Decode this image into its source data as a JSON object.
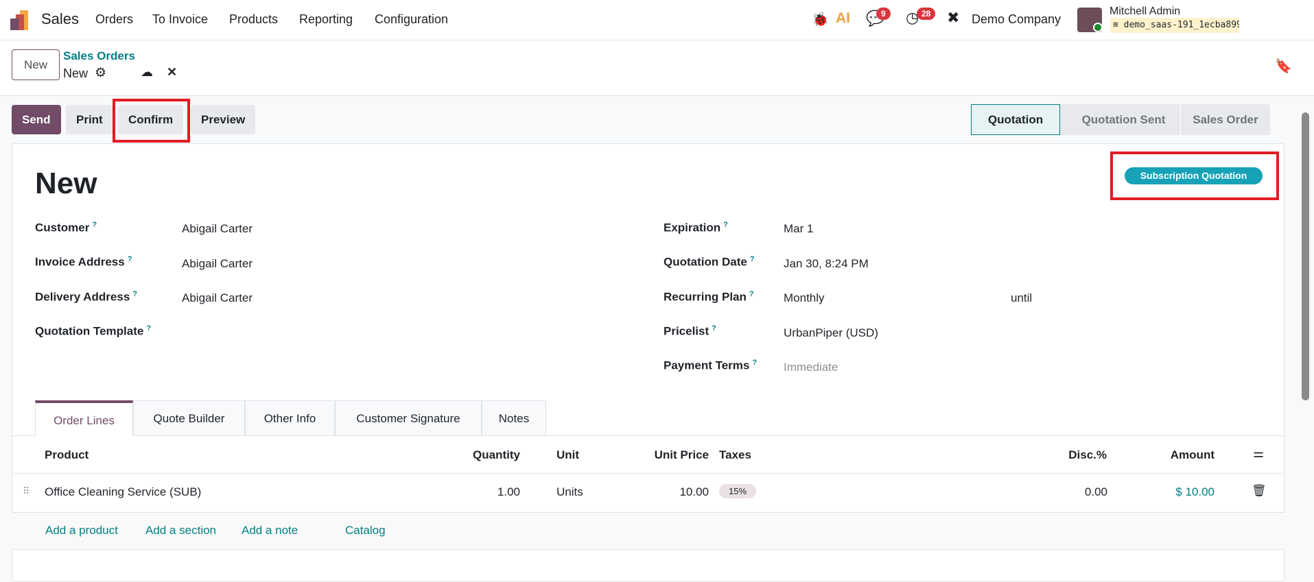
{
  "nav": {
    "app": "Sales",
    "menu": [
      "Orders",
      "To Invoice",
      "Products",
      "Reporting",
      "Configuration"
    ],
    "chat_count": "9",
    "activity_count": "28",
    "company": "Demo Company",
    "user": "Mitchell Admin",
    "database": "demo_saas-191_1ecba8990a5f…"
  },
  "control": {
    "new_label": "New",
    "breadcrumb": "Sales Orders",
    "record": "New"
  },
  "actions": {
    "send": "Send",
    "print": "Print",
    "confirm": "Confirm",
    "preview": "Preview"
  },
  "status": {
    "steps": [
      "Quotation",
      "Quotation Sent",
      "Sales Order"
    ],
    "active": "Quotation"
  },
  "form": {
    "title": "New",
    "badge": "Subscription Quotation",
    "left": [
      {
        "label": "Customer",
        "value": "Abigail Carter"
      },
      {
        "label": "Invoice Address",
        "value": "Abigail Carter"
      },
      {
        "label": "Delivery Address",
        "value": "Abigail Carter"
      },
      {
        "label": "Quotation Template",
        "value": ""
      }
    ],
    "right": [
      {
        "label": "Expiration",
        "value": "Mar 1"
      },
      {
        "label": "Quotation Date",
        "value": "Jan 30, 8:24 PM"
      },
      {
        "label": "Recurring Plan",
        "value": "Monthly"
      },
      {
        "label": "Pricelist",
        "value": "UrbanPiper (USD)"
      },
      {
        "label": "Payment Terms",
        "value": "Immediate"
      }
    ],
    "until": "until",
    "help": "?"
  },
  "tabs": [
    "Order Lines",
    "Quote Builder",
    "Other Info",
    "Customer Signature",
    "Notes"
  ],
  "table": {
    "headers": {
      "product": "Product",
      "quantity": "Quantity",
      "unit": "Unit",
      "unit_price": "Unit Price",
      "taxes": "Taxes",
      "disc": "Disc.%",
      "amount": "Amount"
    },
    "rows": [
      {
        "product": "Office Cleaning Service (SUB)",
        "quantity": "1.00",
        "unit": "Units",
        "unit_price": "10.00",
        "taxes": "15%",
        "disc": "0.00",
        "amount": "$ 10.00"
      }
    ],
    "add_links": [
      "Add a product",
      "Add a section",
      "Add a note",
      "Catalog"
    ]
  },
  "colors": {
    "primary": "#714b67",
    "teal": "#017e84",
    "badge": "#17a2b8"
  }
}
